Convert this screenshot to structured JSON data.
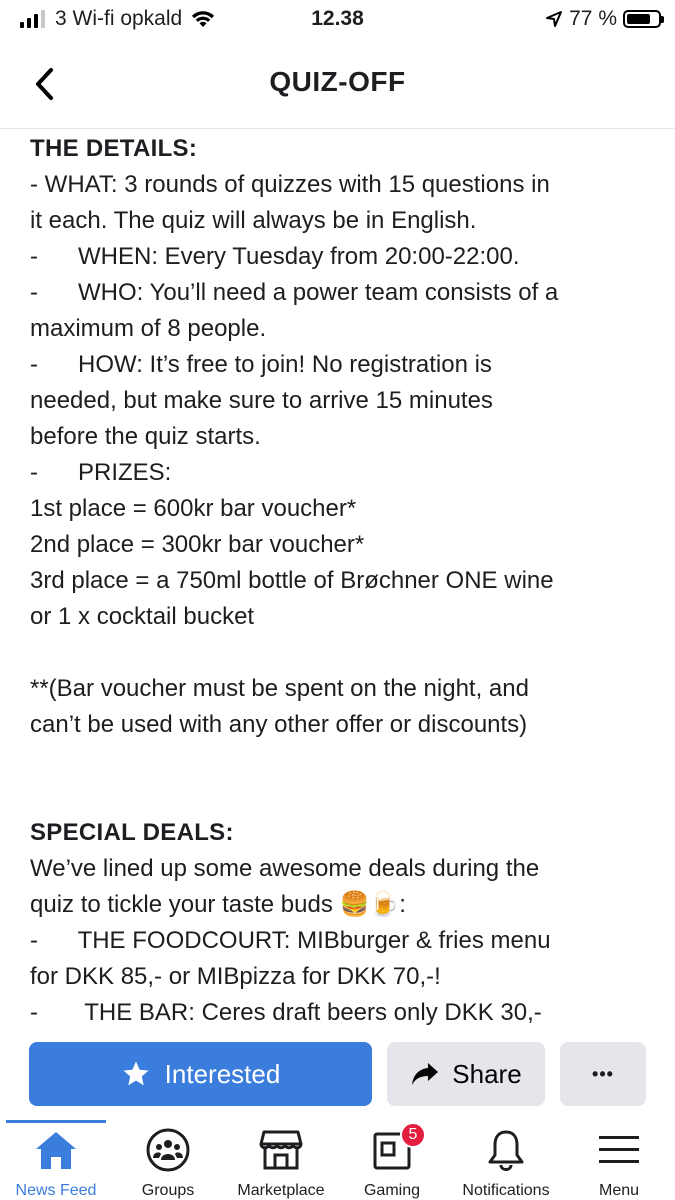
{
  "status_bar": {
    "carrier": "3 Wi-fi opkald",
    "time": "12.38",
    "battery_percent": "77 %",
    "battery_level": 0.77
  },
  "header": {
    "title": "QUIZ-OFF"
  },
  "content": {
    "lines": [
      "THE DETAILS:",
      "- WHAT: 3 rounds of quizzes with 15 questions in",
      "it each. The quiz will always be in English.",
      "-      WHEN: Every Tuesday from 20:00-22:00.",
      "-      WHO: You’ll need a power team consists of a",
      "maximum of 8 people.",
      "-      HOW: It’s free to join! No registration is",
      "needed, but make sure to arrive 15 minutes",
      "before the quiz starts.",
      "-      PRIZES:",
      "1st place = 600kr bar voucher*",
      "2nd place = 300kr bar voucher*",
      "3rd place = a 750ml bottle of Brøchner ONE wine",
      "or 1 x cocktail bucket",
      "",
      "**(Bar voucher must be spent on the night, and",
      "can’t be used with any other offer or discounts)",
      "",
      "",
      "SPECIAL DEALS:",
      "We’ve lined up some awesome deals during the",
      "quiz to tickle your taste buds 🍔🍺:",
      "-      THE FOODCOURT: MIBburger & fries menu",
      "for DKK 85,- or MIBpizza for DKK 70,-!",
      "-       THE BAR: Ceres draft beers only DKK 30,-"
    ]
  },
  "actions": {
    "interested_label": "Interested",
    "share_label": "Share",
    "more_label": "•••",
    "accent_color": "#3b7ddd"
  },
  "nav": {
    "items": [
      {
        "label": "News Feed",
        "icon": "home-icon",
        "active": true
      },
      {
        "label": "Groups",
        "icon": "groups-icon"
      },
      {
        "label": "Marketplace",
        "icon": "marketplace-icon"
      },
      {
        "label": "Gaming",
        "icon": "gaming-icon",
        "badge": "5"
      },
      {
        "label": "Notifications",
        "icon": "bell-icon"
      },
      {
        "label": "Menu",
        "icon": "menu-icon"
      }
    ]
  }
}
